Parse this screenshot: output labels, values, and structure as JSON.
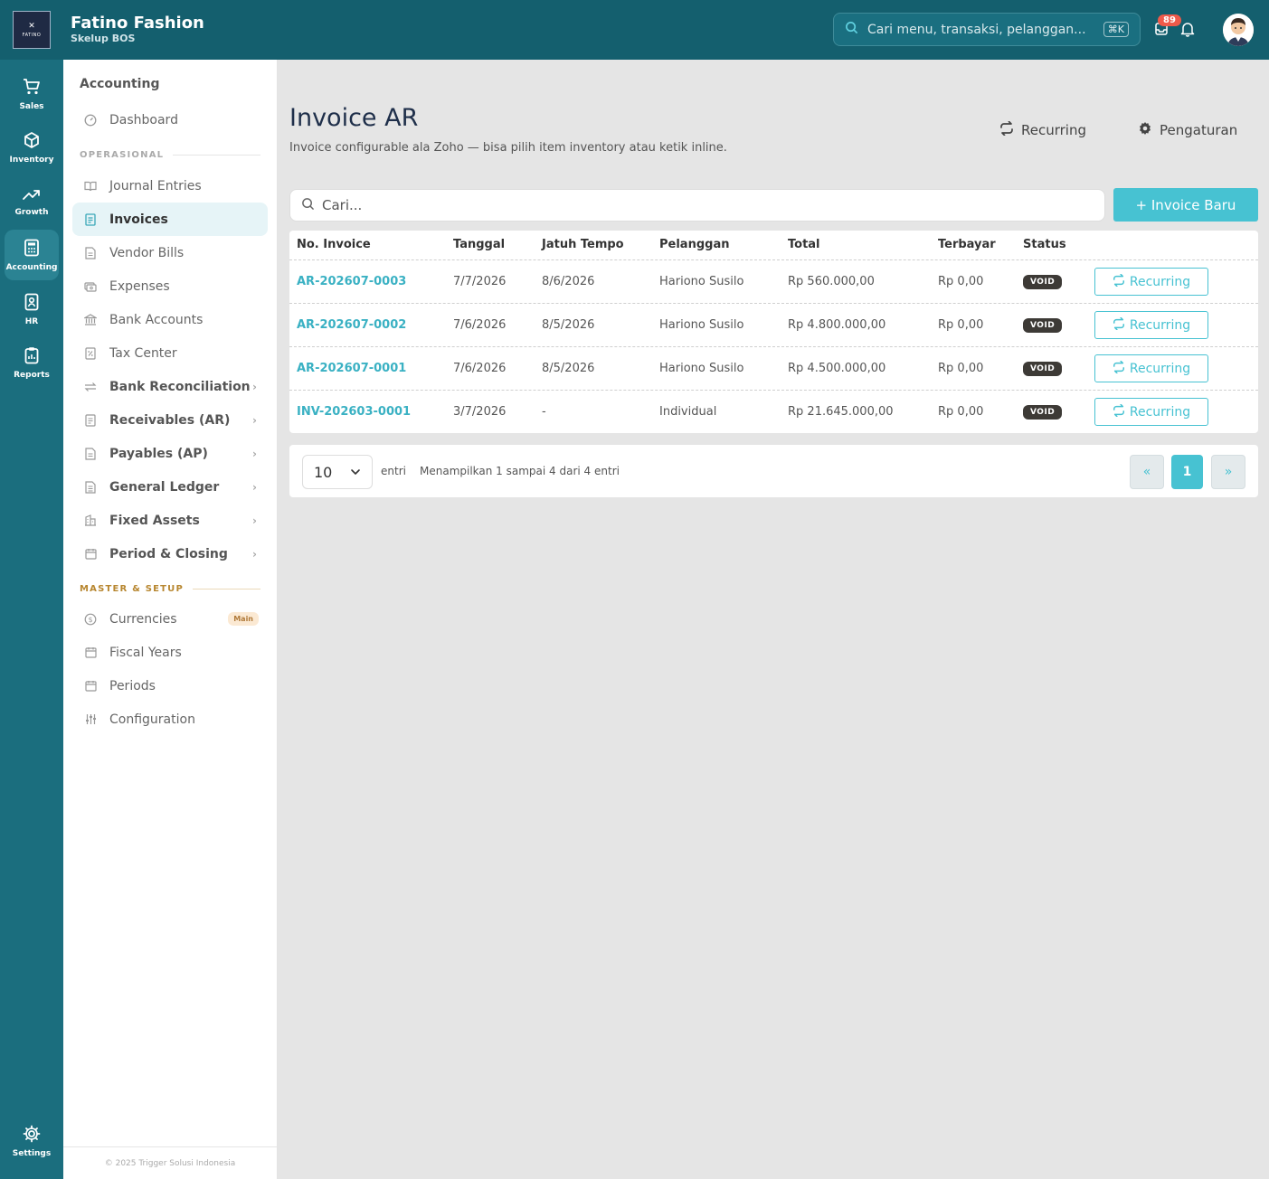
{
  "brand": {
    "logo_mark": "✕",
    "logo_text": "FATINO",
    "name": "Fatino Fashion",
    "subtitle": "Skelup BOS"
  },
  "topbar": {
    "search_placeholder": "Cari menu, transaksi, pelanggan...",
    "shortcut": "⌘K",
    "notification_count": "89"
  },
  "rail": [
    {
      "label": "Sales",
      "icon": "cart-icon"
    },
    {
      "label": "Inventory",
      "icon": "box-icon"
    },
    {
      "label": "Growth",
      "icon": "trend-up-icon"
    },
    {
      "label": "Accounting",
      "icon": "calculator-icon",
      "active": true
    },
    {
      "label": "HR",
      "icon": "id-badge-icon"
    },
    {
      "label": "Reports",
      "icon": "clipboard-icon"
    },
    {
      "label": "Settings",
      "icon": "gear-icon"
    }
  ],
  "sidebar": {
    "title": "Accounting",
    "dashboard": "Dashboard",
    "section_ops": "OPERASIONAL",
    "ops": [
      {
        "label": "Journal Entries"
      },
      {
        "label": "Invoices",
        "active": true
      },
      {
        "label": "Vendor Bills"
      },
      {
        "label": "Expenses"
      },
      {
        "label": "Bank Accounts"
      },
      {
        "label": "Tax Center"
      },
      {
        "label": "Bank Reconciliation"
      },
      {
        "label": "Receivables (AR)"
      },
      {
        "label": "Payables (AP)"
      },
      {
        "label": "General Ledger"
      },
      {
        "label": "Fixed Assets"
      },
      {
        "label": "Period & Closing"
      }
    ],
    "section_master": "MASTER & SETUP",
    "master": [
      {
        "label": "Currencies",
        "tag": "Main"
      },
      {
        "label": "Fiscal Years"
      },
      {
        "label": "Periods"
      },
      {
        "label": "Configuration"
      }
    ],
    "footer": "© 2025 Trigger Solusi Indonesia"
  },
  "page": {
    "title": "Invoice AR",
    "subtitle": "Invoice configurable ala Zoho — bisa pilih item inventory atau ketik inline.",
    "recurring_label": "Recurring",
    "settings_label": "Pengaturan",
    "search_placeholder": "Cari...",
    "new_button": "+ Invoice Baru"
  },
  "table": {
    "headers": [
      "No. Invoice",
      "Tanggal",
      "Jatuh Tempo",
      "Pelanggan",
      "Total",
      "Terbayar",
      "Status"
    ],
    "rows": [
      {
        "no": "AR-202607-0003",
        "date": "7/7/2026",
        "due": "8/6/2026",
        "customer": "Hariono Susilo",
        "total": "Rp 560.000,00",
        "paid": "Rp 0,00",
        "status": "VOID",
        "action": "Recurring"
      },
      {
        "no": "AR-202607-0002",
        "date": "7/6/2026",
        "due": "8/5/2026",
        "customer": "Hariono Susilo",
        "total": "Rp 4.800.000,00",
        "paid": "Rp 0,00",
        "status": "VOID",
        "action": "Recurring"
      },
      {
        "no": "AR-202607-0001",
        "date": "7/6/2026",
        "due": "8/5/2026",
        "customer": "Hariono Susilo",
        "total": "Rp 4.500.000,00",
        "paid": "Rp 0,00",
        "status": "VOID",
        "action": "Recurring"
      },
      {
        "no": "INV-202603-0001",
        "date": "3/7/2026",
        "due": "-",
        "customer": "Individual",
        "total": "Rp 21.645.000,00",
        "paid": "Rp 0,00",
        "status": "VOID",
        "action": "Recurring"
      }
    ]
  },
  "pagination": {
    "per_page": "10",
    "entries_label": "entri",
    "info": "Menampilkan 1 sampai 4 dari 4 entri",
    "prev": "«",
    "current": "1",
    "next": "»"
  },
  "colors": {
    "topbar": "#145f6e",
    "rail": "#1b6e7e",
    "accent": "#47c2d2",
    "void_badge": "#3d3a36",
    "master_section": "#b7862f"
  }
}
